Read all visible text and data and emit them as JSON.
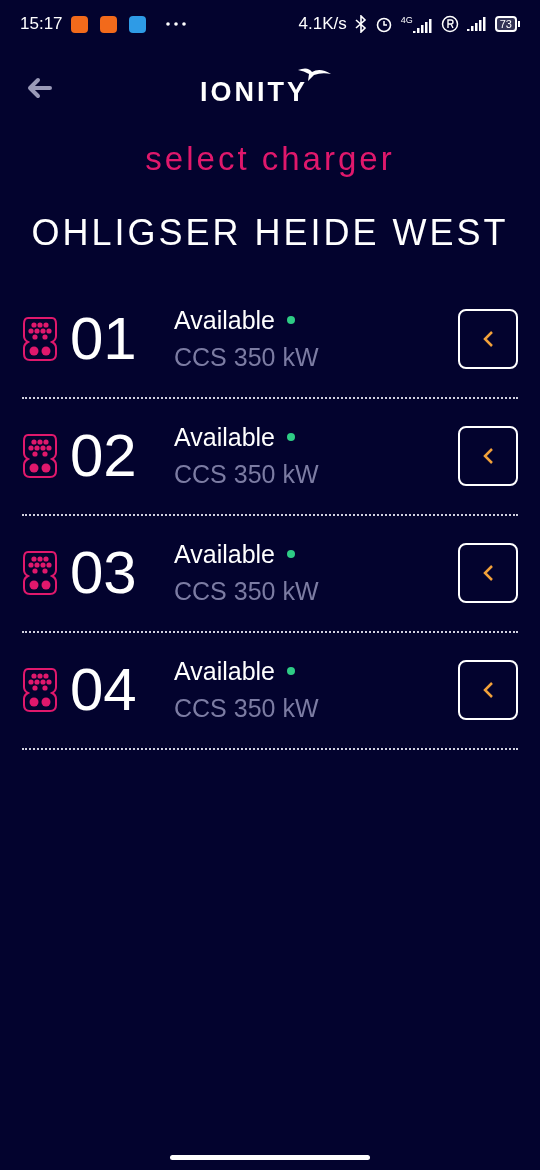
{
  "status_bar": {
    "time": "15:17",
    "speed": "4.1K/s",
    "network": "4G",
    "battery": "73"
  },
  "header": {
    "logo": "IONITY"
  },
  "title": "select charger",
  "station": "OHLIGSER HEIDE WEST",
  "chargers": [
    {
      "number": "01",
      "status": "Available",
      "color": "#2ecc85",
      "connector": "CCS 350 kW"
    },
    {
      "number": "02",
      "status": "Available",
      "color": "#2ecc85",
      "connector": "CCS 350 kW"
    },
    {
      "number": "03",
      "status": "Available",
      "color": "#2ecc85",
      "connector": "CCS 350 kW"
    },
    {
      "number": "04",
      "status": "Available",
      "color": "#2ecc85",
      "connector": "CCS 350 kW"
    }
  ]
}
